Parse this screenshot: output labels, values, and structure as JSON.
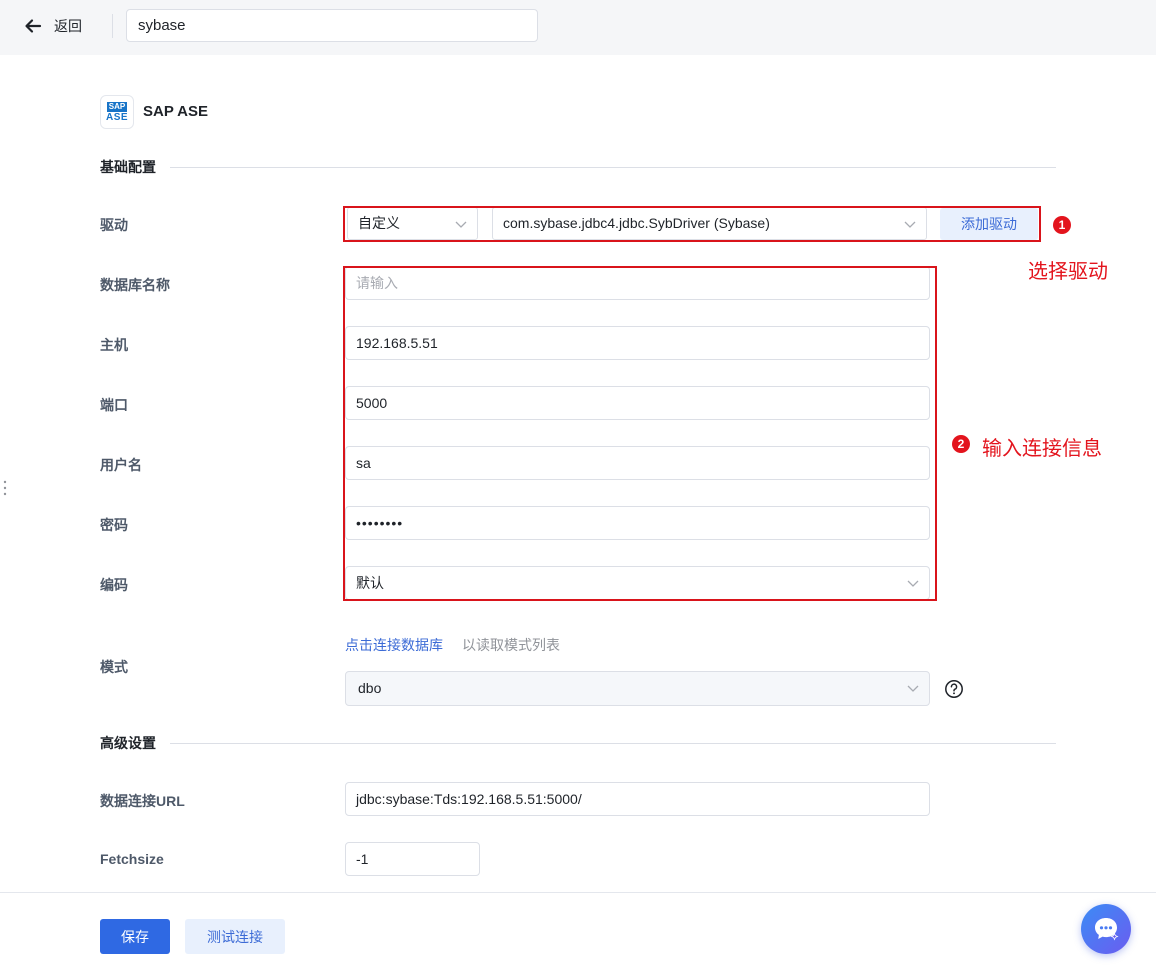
{
  "header": {
    "back_label": "返回",
    "name_value": "sybase"
  },
  "datasource": {
    "logo_line1": "SAP",
    "logo_line2": "ASE",
    "name": "SAP ASE"
  },
  "sections": {
    "basic": "基础配置",
    "advanced": "高级设置"
  },
  "form": {
    "driver_label": "驱动",
    "driver_type": "自定义",
    "driver_class": "com.sybase.jdbc4.jdbc.SybDriver (Sybase)",
    "add_driver_label": "添加驱动",
    "dbname_label": "数据库名称",
    "dbname_placeholder": "请输入",
    "host_label": "主机",
    "host_value": "192.168.5.51",
    "port_label": "端口",
    "port_value": "5000",
    "username_label": "用户名",
    "username_value": "sa",
    "password_label": "密码",
    "password_value": "••••••••",
    "encoding_label": "编码",
    "encoding_value": "默认",
    "schema_label": "模式",
    "schema_link": "点击连接数据库",
    "schema_hint": "以读取模式列表",
    "schema_value": "dbo",
    "url_label": "数据连接URL",
    "url_value": "jdbc:sybase:Tds:192.168.5.51:5000/",
    "fetchsize_label": "Fetchsize",
    "fetchsize_value": "-1"
  },
  "annotations": {
    "step1_number": "1",
    "step1_text": "选择驱动",
    "step2_number": "2",
    "step2_text": "输入连接信息"
  },
  "footer": {
    "save_label": "保存",
    "test_label": "测试连接"
  },
  "colors": {
    "primary": "#2f69e3",
    "annotation_red": "#e3141d"
  }
}
